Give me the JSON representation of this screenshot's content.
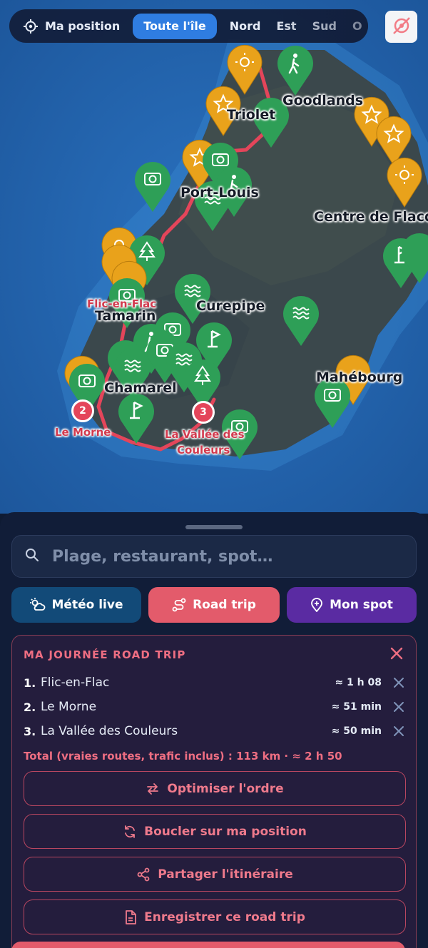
{
  "topbar": {
    "location_label": "Ma position",
    "regions": [
      "Toute l'île",
      "Nord",
      "Est",
      "Sud",
      "O"
    ],
    "active_region": "Toute l'île"
  },
  "map": {
    "places": [
      "Goodlands",
      "Triolet",
      "Port-Louis",
      "Centre de Flacq",
      "Flic-en-Flac",
      "Tamarin",
      "Curepipe",
      "Chamarel",
      "Mahébourg",
      "Le Morne",
      "La Vallée des",
      "Couleurs"
    ],
    "route_stops": [
      "2",
      "3"
    ],
    "colors": {
      "beach_pin": "#2e9f57",
      "highlight_pin": "#e9a21b",
      "route": "#e4455a",
      "sea": "#2260a8",
      "land": "#3d4b4f"
    }
  },
  "sheet": {
    "search_placeholder": "Plage, restaurant, spot…",
    "actions": {
      "weather": "Météo live",
      "roadtrip": "Road trip",
      "myspot": "Mon spot"
    },
    "roadtrip": {
      "title": "MA JOURNÉE ROAD TRIP",
      "stops": [
        {
          "num": "1.",
          "name": "Flic-en-Flac",
          "duration": "≈ 1 h 08"
        },
        {
          "num": "2.",
          "name": "Le Morne",
          "duration": "≈ 51 min"
        },
        {
          "num": "3.",
          "name": "La Vallée des Couleurs",
          "duration": "≈ 50 min"
        }
      ],
      "total": "Total (vraies routes, trafic inclus) : 113 km · ≈ 2 h 50",
      "buttons": {
        "optimize": "Optimiser l'ordre",
        "loop": "Boucler sur ma position",
        "share": "Partager l'itinéraire",
        "save": "Enregistrer ce road trip"
      }
    }
  }
}
